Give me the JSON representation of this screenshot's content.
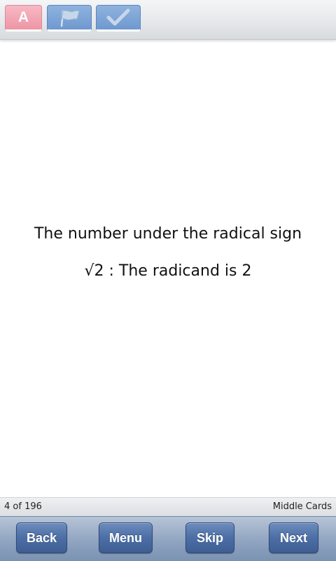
{
  "toolbar": {
    "font_button_letter": "A",
    "icons": [
      "font-size-icon",
      "flag-icon",
      "checkmark-icon"
    ],
    "colors": {
      "pink": "#ee95a5",
      "blue": "#6e98cf"
    }
  },
  "card": {
    "line1": "The number under the radical sign",
    "line2": "√2 : The radicand is 2"
  },
  "status": {
    "position": "4 of 196",
    "deck": "Middle Cards"
  },
  "nav": {
    "back": "Back",
    "menu": "Menu",
    "skip": "Skip",
    "next": "Next"
  }
}
